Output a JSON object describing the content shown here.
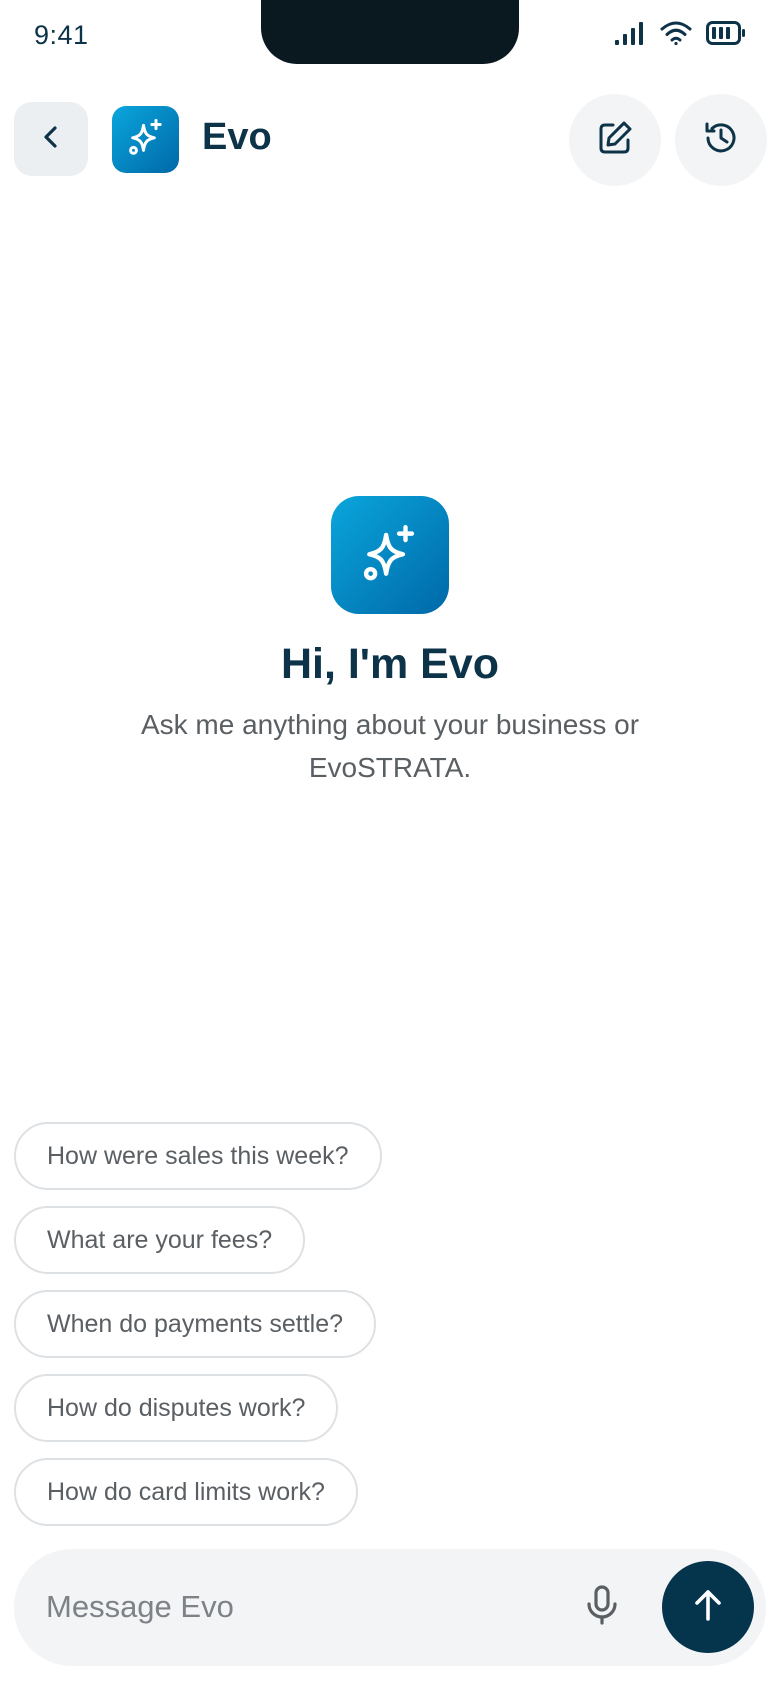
{
  "status_bar": {
    "time": "9:41",
    "icons": [
      "signal-icon",
      "wifi-icon",
      "battery-icon"
    ]
  },
  "header": {
    "title": "Evo",
    "back_icon": "chevron-left-icon",
    "logo_icon": "sparkles-icon",
    "new_chat_icon": "edit-icon",
    "history_icon": "history-icon"
  },
  "hero": {
    "icon": "sparkles-icon",
    "title": "Hi, I'm Evo",
    "subtitle": "Ask me anything about your business or EvoSTRATA."
  },
  "suggestions": [
    "How were sales this week?",
    "What are your fees?",
    "When do payments settle?",
    "How do disputes work?",
    "How do card limits work?"
  ],
  "composer": {
    "placeholder": "Message Evo",
    "value": "",
    "mic_icon": "microphone-icon",
    "send_icon": "arrow-up-icon"
  },
  "colors": {
    "brand_dark": "#0d3349",
    "brand_gradient_start": "#0aa6dc",
    "brand_gradient_end": "#0068a8",
    "send_button": "#05344d"
  }
}
